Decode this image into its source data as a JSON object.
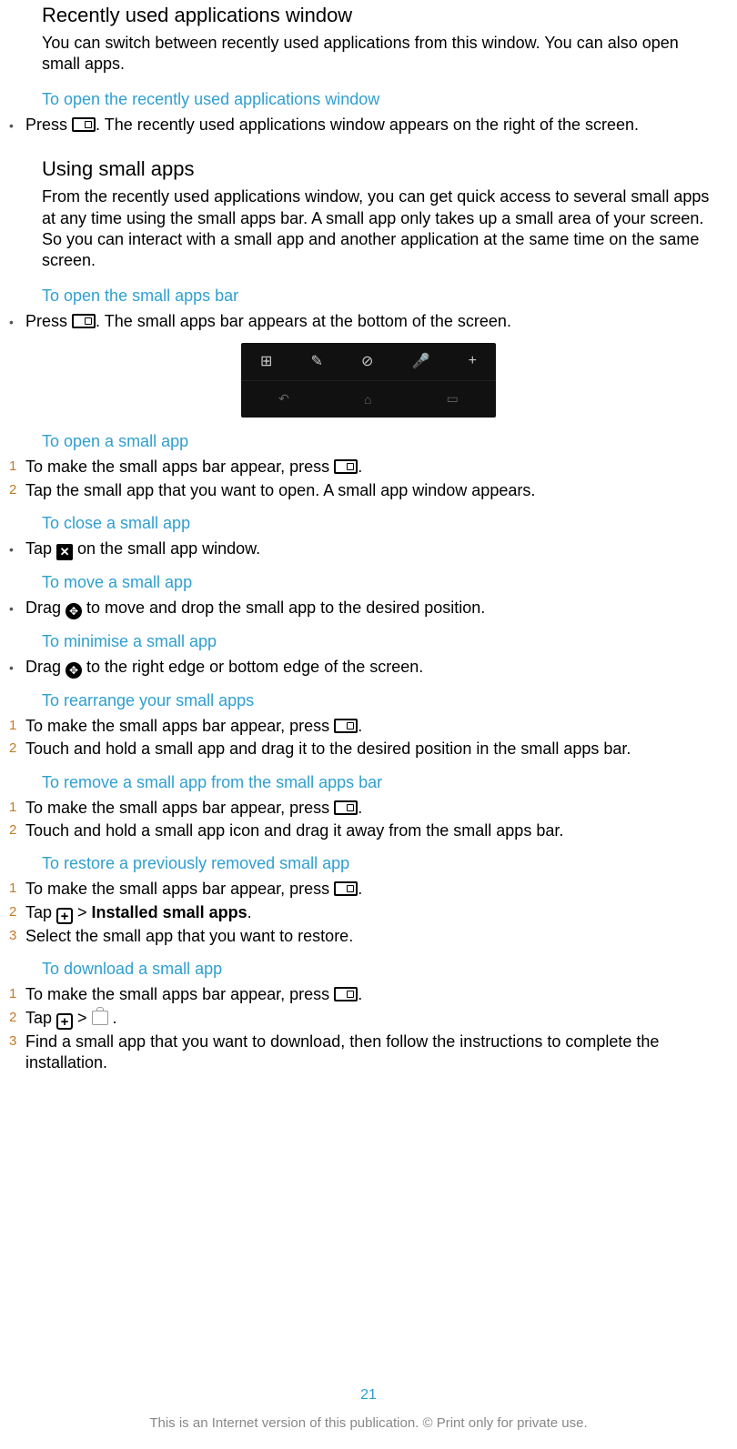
{
  "h_recent": "Recently used applications window",
  "p_recent": "You can switch between recently used applications from this window. You can also open small apps.",
  "sub_open_recent": "To open the recently used applications window",
  "open_recent_a": "Press ",
  "open_recent_b": ". The recently used applications window appears on the right of the screen.",
  "h_small": "Using small apps",
  "p_small": "From the recently used applications window, you can get quick access to several small apps at any time using the small apps bar. A small app only takes up a small area of your screen. So you can interact with a small app and another application at the same time on the same screen.",
  "sub_open_bar": "To open the small apps bar",
  "open_bar_a": "Press ",
  "open_bar_b": ". The small apps bar appears at the bottom of the screen.",
  "sub_open_small": "To open a small app",
  "open_small_1a": "To make the small apps bar appear, press ",
  "open_small_1b": ".",
  "open_small_2": "Tap the small app that you want to open. A small app window appears.",
  "sub_close": "To close a small app",
  "close_a": "Tap ",
  "close_b": " on the small app window.",
  "sub_move": "To move a small app",
  "move_a": "Drag ",
  "move_b": " to move and drop the small app to the desired position.",
  "sub_min": "To minimise a small app",
  "min_a": "Drag ",
  "min_b": " to the right edge or bottom edge of the screen.",
  "sub_rearr": "To rearrange your small apps",
  "rearr_1a": "To make the small apps bar appear, press ",
  "rearr_1b": ".",
  "rearr_2": "Touch and hold a small app and drag it to the desired position in the small apps bar.",
  "sub_remove": "To remove a small app from the small apps bar",
  "remove_1a": "To make the small apps bar appear, press ",
  "remove_1b": ".",
  "remove_2": "Touch and hold a small app icon and drag it away from the small apps bar.",
  "sub_restore": "To restore a previously removed small app",
  "restore_1a": "To make the small apps bar appear, press ",
  "restore_1b": ".",
  "restore_2a": "Tap ",
  "restore_2b": " > ",
  "restore_2c": "Installed small apps",
  "restore_2d": ".",
  "restore_3": "Select the small app that you want to restore.",
  "sub_download": "To download a small app",
  "download_1a": "To make the small apps bar appear, press ",
  "download_1b": ".",
  "download_2a": "Tap ",
  "download_2b": " > ",
  "download_2c": " .",
  "download_3": "Find a small app that you want to download, then follow the instructions to complete the installation.",
  "pagenum": "21",
  "footer": "This is an Internet version of this publication. © Print only for private use.",
  "markers": {
    "bullet": "•",
    "n1": "1",
    "n2": "2",
    "n3": "3"
  },
  "bar_icons": [
    "⊞",
    "✎",
    "⊘",
    "🎤",
    "+"
  ],
  "nav_icons": [
    "↶",
    "⌂",
    "▭"
  ]
}
